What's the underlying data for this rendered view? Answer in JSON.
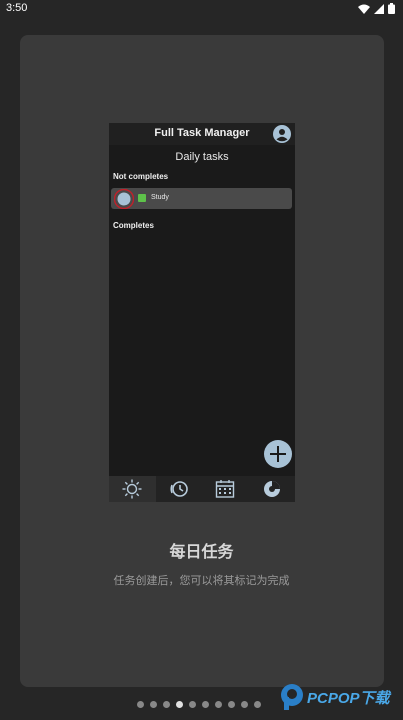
{
  "status": {
    "time": "3:50"
  },
  "phone": {
    "app_title": "Full Task Manager",
    "screen_title": "Daily tasks",
    "section_not_completed": "Not completes",
    "section_completed": "Completes",
    "tasks": [
      {
        "name": "Study",
        "color": "#5ec24a"
      }
    ],
    "nav": [
      {
        "icon": "sun-icon"
      },
      {
        "icon": "history-icon"
      },
      {
        "icon": "calendar-icon"
      },
      {
        "icon": "pie-chart-icon"
      }
    ]
  },
  "caption": {
    "title": "每日任务",
    "subtitle": "任务创建后，您可以将其标记为完成"
  },
  "pager": {
    "total": 10,
    "active": 4
  },
  "watermark": {
    "text": "PCPOP下载"
  }
}
